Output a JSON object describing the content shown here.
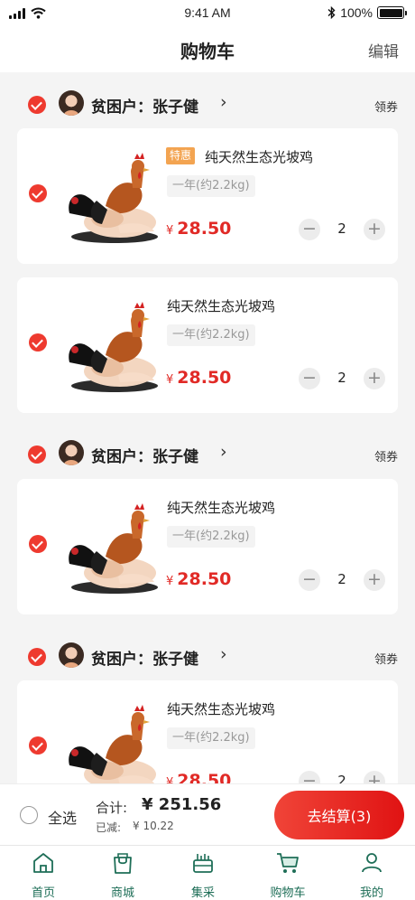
{
  "status_bar": {
    "time": "9:41 AM",
    "battery": "100%",
    "battery_level": 1.0
  },
  "header": {
    "title": "购物车",
    "edit_label": "编辑"
  },
  "stores": [
    {
      "label": "贫困户：",
      "name": "张子健",
      "coupon": "领券",
      "checked": true,
      "items": [
        {
          "badge": "特惠",
          "name": "纯天然生态光坡鸡",
          "spec": "一年(约2.2kg)",
          "currency": "¥",
          "price": "28.50",
          "quantity": "2",
          "checked": true
        },
        {
          "badge": "",
          "name": "纯天然生态光坡鸡",
          "spec": "一年(约2.2kg)",
          "currency": "¥",
          "price": "28.50",
          "quantity": "2",
          "checked": true
        }
      ]
    },
    {
      "label": "贫困户：",
      "name": "张子健",
      "coupon": "领券",
      "checked": true,
      "items": [
        {
          "badge": "",
          "name": "纯天然生态光坡鸡",
          "spec": "一年(约2.2kg)",
          "currency": "¥",
          "price": "28.50",
          "quantity": "2",
          "checked": true
        }
      ]
    },
    {
      "label": "贫困户：",
      "name": "张子健",
      "coupon": "领券",
      "checked": true,
      "items": [
        {
          "badge": "",
          "name": "纯天然生态光坡鸡",
          "spec": "一年(约2.2kg)",
          "currency": "¥",
          "price": "28.50",
          "quantity": "2",
          "checked": true
        }
      ]
    }
  ],
  "checkout": {
    "select_all_label": "全选",
    "total_label": "合计:",
    "total_amount": "¥ 251.56",
    "saved_label": "已减:",
    "saved_amount": "¥ 10.22",
    "button_label": "去结算(3)"
  },
  "tabbar": [
    {
      "label": "首页",
      "icon": "home-icon"
    },
    {
      "label": "商城",
      "icon": "shopping-bag-icon"
    },
    {
      "label": "集采",
      "icon": "basket-icon"
    },
    {
      "label": "购物车",
      "icon": "cart-icon",
      "active": true
    },
    {
      "label": "我的",
      "icon": "user-icon"
    }
  ],
  "colors": {
    "accent_red": "#e12a26",
    "tab_green": "#1e6e57",
    "badge_orange": "#f3a451"
  }
}
